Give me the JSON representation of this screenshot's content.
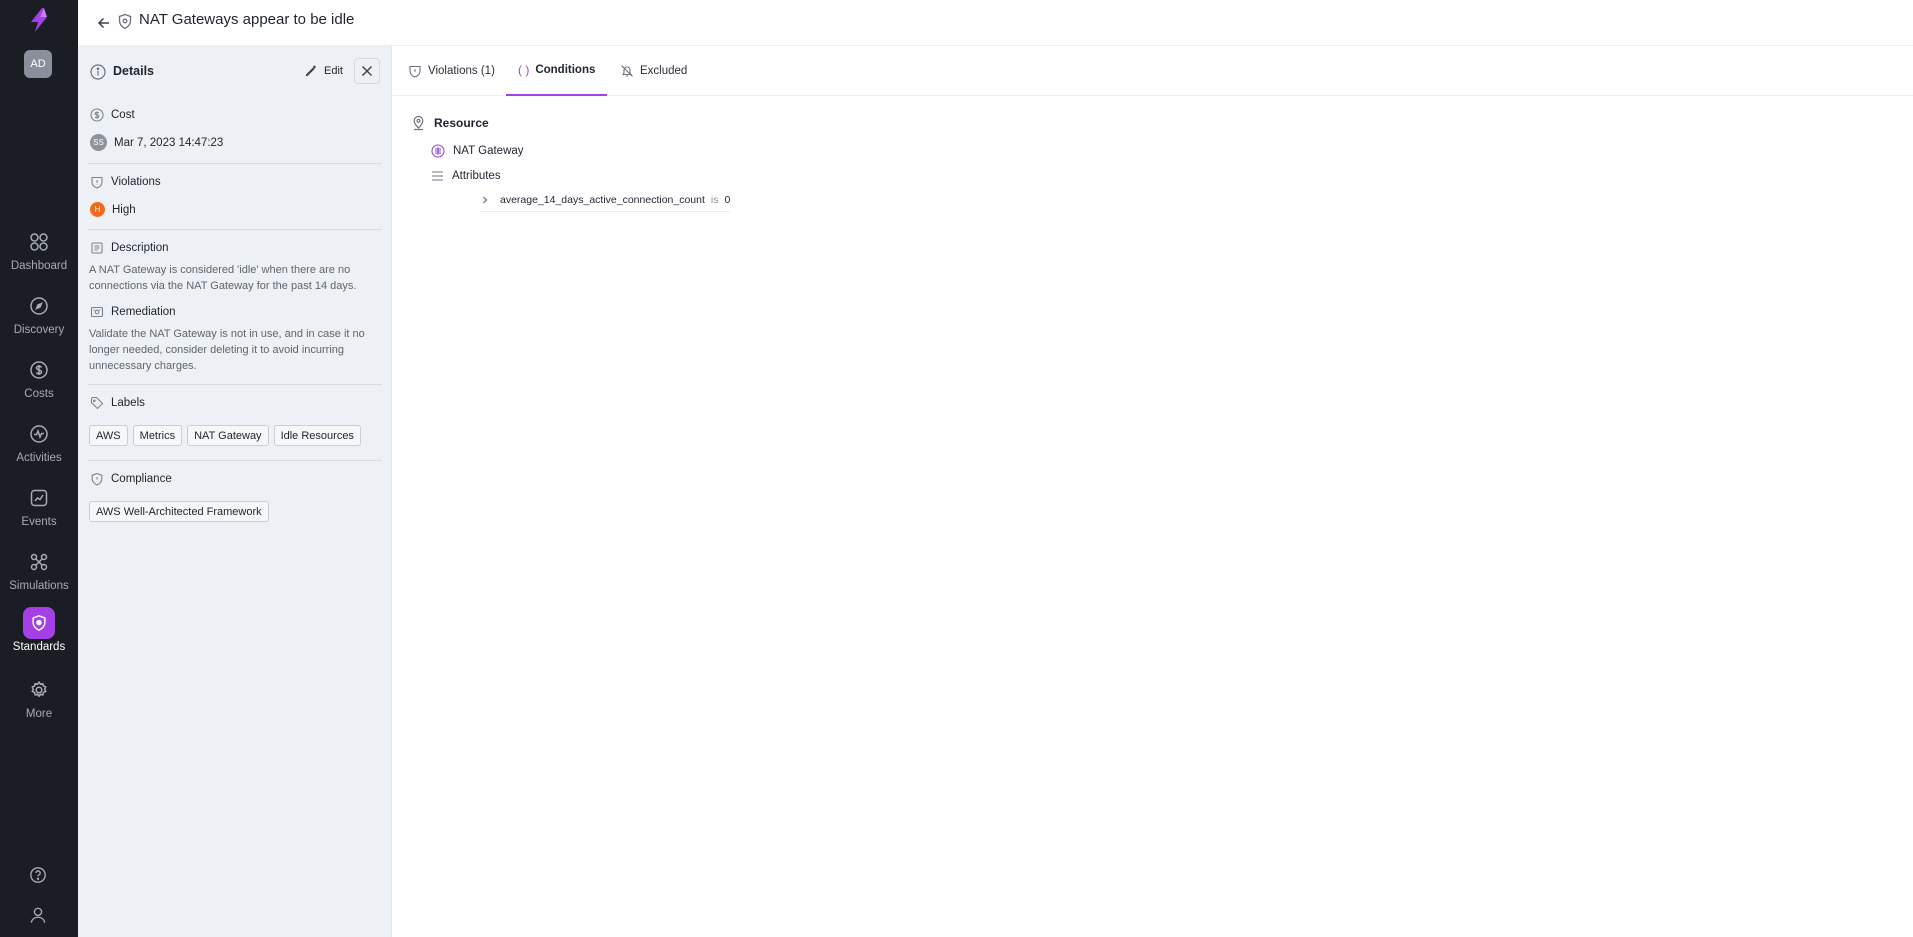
{
  "header": {
    "title": "NAT Gateways appear to be idle"
  },
  "user": {
    "initials": "AD"
  },
  "nav": {
    "items": [
      {
        "label": "Dashboard",
        "icon": "grid-icon"
      },
      {
        "label": "Discovery",
        "icon": "compass-icon"
      },
      {
        "label": "Costs",
        "icon": "dollar-icon"
      },
      {
        "label": "Activities",
        "icon": "activity-icon"
      },
      {
        "label": "Events",
        "icon": "chart-line-icon"
      },
      {
        "label": "Simulations",
        "icon": "simulation-icon"
      },
      {
        "label": "Standards",
        "icon": "shield-icon",
        "active": true
      },
      {
        "label": "More",
        "icon": "gear-icon"
      }
    ]
  },
  "panel": {
    "title": "Details",
    "edit_label": "Edit",
    "cost": {
      "label": "Cost",
      "author_initials": "SS",
      "timestamp": "Mar 7, 2023 14:47:23"
    },
    "violations": {
      "label": "Violations",
      "severity_initial": "H",
      "severity": "High"
    },
    "description": {
      "label": "Description",
      "text": "A NAT Gateway is considered 'idle' when there are no connections via the NAT Gateway for the past 14 days."
    },
    "remediation": {
      "label": "Remediation",
      "text": "Validate the NAT Gateway is not in use, and in case it no longer needed, consider deleting it to avoid incurring unnecessary charges."
    },
    "labels": {
      "label": "Labels",
      "items": [
        "AWS",
        "Metrics",
        "NAT Gateway",
        "Idle Resources"
      ]
    },
    "compliance": {
      "label": "Compliance",
      "items": [
        "AWS Well-Architected Framework"
      ]
    }
  },
  "tabs": [
    {
      "label": "Violations (1)"
    },
    {
      "label": "Conditions",
      "active": true
    },
    {
      "label": "Excluded"
    }
  ],
  "conditions": {
    "section_label": "Resource",
    "resource_type": "NAT Gateway",
    "attributes_label": "Attributes",
    "attribute": {
      "name": "average_14_days_active_connection_count",
      "operator": "is",
      "value": "0"
    }
  },
  "colors": {
    "accent": "#a440e6",
    "rail": "#1b1d24",
    "panel": "#edf0f4",
    "severity_high": "#f06a1d"
  }
}
